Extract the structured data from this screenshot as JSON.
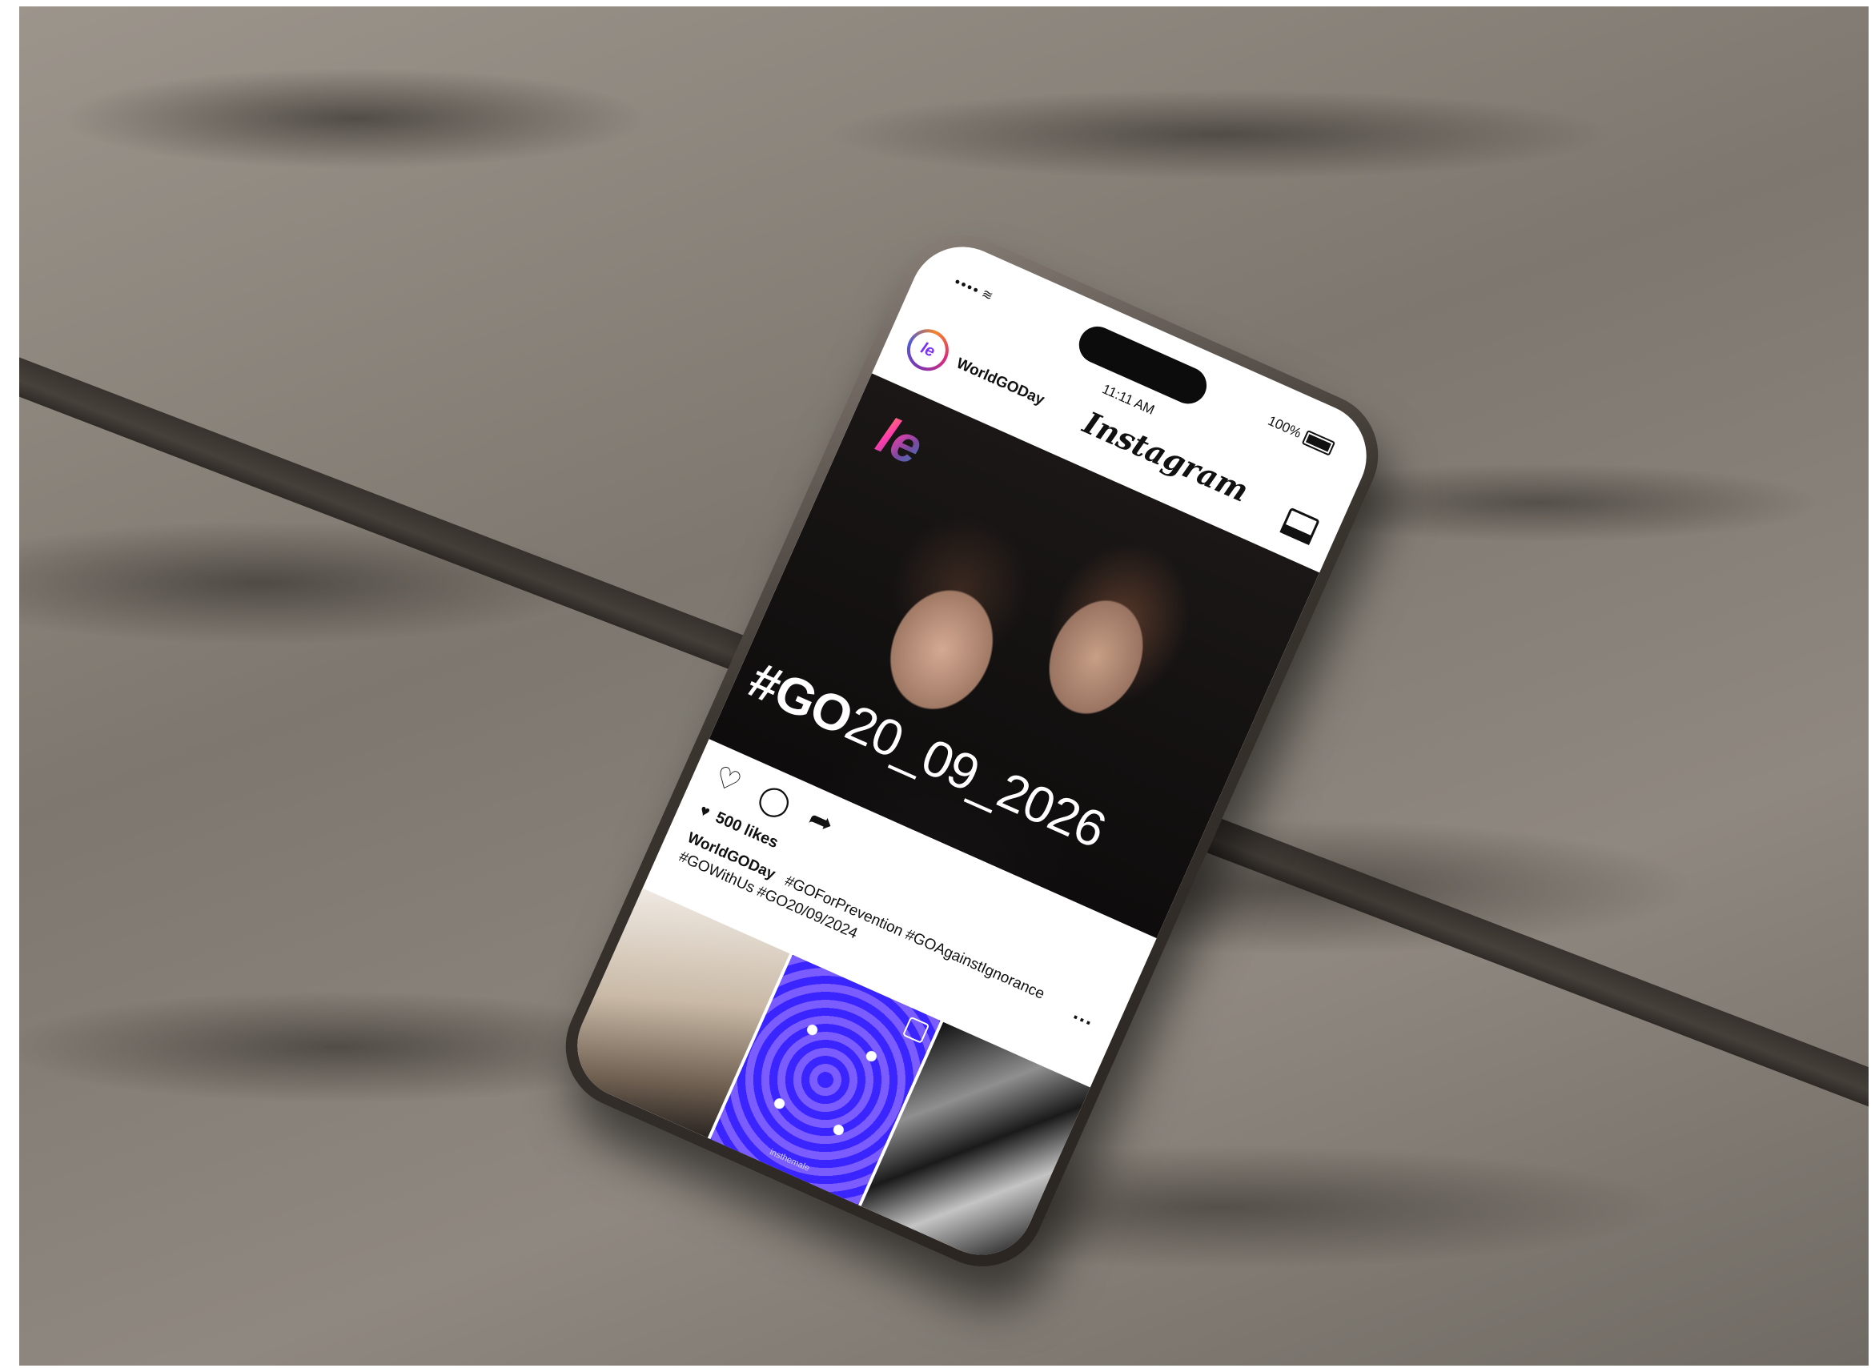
{
  "status_bar": {
    "signal": "••••",
    "wifi": "wifi-icon",
    "time": "11:11 AM",
    "battery": "100%"
  },
  "header": {
    "app_title": "Instagram",
    "username": "WorldGODay",
    "avatar_letter": "le"
  },
  "post": {
    "logo_text": "le",
    "hashtag_bold": "#GO",
    "hashtag_thin": "20_09_2026",
    "likes": "500 likes",
    "caption_user": "WorldGODay",
    "caption_tags": "#GOForPrevention #GOAgainstIgnorance #GOWithUs #GO20/09/2024"
  },
  "grid": {
    "tile2_label": "insthemale"
  },
  "colors": {
    "accent_gradient": [
      "#ff9a3c",
      "#ff3cac",
      "#784ba0",
      "#2b86c5"
    ],
    "tile_blue": "#2a1cff"
  }
}
